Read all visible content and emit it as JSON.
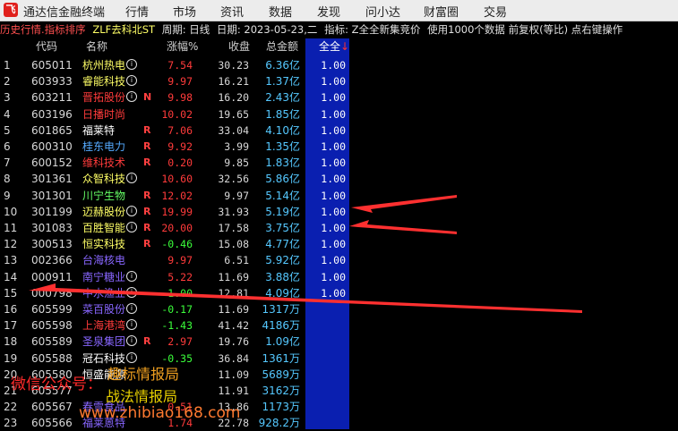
{
  "app": {
    "title": "通达信金融终端"
  },
  "menu": [
    "行情",
    "市场",
    "资讯",
    "数据",
    "发现",
    "问小达",
    "财富圈",
    "交易"
  ],
  "infobar": {
    "mode": "历史行情.指标排序",
    "formula": "ZLF去科北ST",
    "period": "周期: 日线",
    "date": "日期: 2023-05-23,二",
    "indicator": "指标: Z全全新集竞价",
    "data_note": "使用1000个数据 前复权(等比) 点右键操作"
  },
  "headers": {
    "code": "代码",
    "name": "名称",
    "chg": "涨幅%",
    "close": "收盘",
    "amount": "总金额",
    "all": "全全"
  },
  "colors": {
    "up": "#ff3b3b",
    "down": "#3bff3b",
    "name_default": "#ffff66",
    "selected_col": "#0a1fb0",
    "arrow": "#ff3030"
  },
  "rows": [
    {
      "idx": "1",
      "code": "605011",
      "name": "杭州热电",
      "info": true,
      "flag": "",
      "chg": "7.54",
      "close": "30.23",
      "amount": "6.36亿",
      "all": "1.00",
      "nc": "#ffff66",
      "cc": "#ff3b3b"
    },
    {
      "idx": "2",
      "code": "603933",
      "name": "睿能科技",
      "info": true,
      "flag": "",
      "chg": "9.97",
      "close": "16.21",
      "amount": "1.37亿",
      "all": "1.00",
      "nc": "#ffff66",
      "cc": "#ff3b3b"
    },
    {
      "idx": "3",
      "code": "603211",
      "name": "晋拓股份",
      "info": true,
      "flag": "N",
      "chg": "9.98",
      "close": "16.20",
      "amount": "2.43亿",
      "all": "1.00",
      "nc": "#ff3b3b",
      "cc": "#ff3b3b"
    },
    {
      "idx": "4",
      "code": "603196",
      "name": "日播时尚",
      "info": false,
      "flag": "",
      "chg": "10.02",
      "close": "19.65",
      "amount": "1.85亿",
      "all": "1.00",
      "nc": "#ff3b3b",
      "cc": "#ff3b3b"
    },
    {
      "idx": "5",
      "code": "601865",
      "name": "福莱特",
      "info": false,
      "flag": "R",
      "chg": "7.06",
      "close": "33.04",
      "amount": "4.10亿",
      "all": "1.00",
      "nc": "#ffffff",
      "cc": "#ff3b3b"
    },
    {
      "idx": "6",
      "code": "600310",
      "name": "桂东电力",
      "info": false,
      "flag": "R",
      "chg": "9.92",
      "close": "3.99",
      "amount": "1.35亿",
      "all": "1.00",
      "nc": "#55aaff",
      "cc": "#ff3b3b"
    },
    {
      "idx": "7",
      "code": "600152",
      "name": "维科技术",
      "info": false,
      "flag": "R",
      "chg": "0.20",
      "close": "9.85",
      "amount": "1.83亿",
      "all": "1.00",
      "nc": "#ff3b3b",
      "cc": "#ff3b3b"
    },
    {
      "idx": "8",
      "code": "301361",
      "name": "众智科技",
      "info": true,
      "flag": "",
      "chg": "10.60",
      "close": "32.56",
      "amount": "5.86亿",
      "all": "1.00",
      "nc": "#ffff66",
      "cc": "#ff3b3b"
    },
    {
      "idx": "9",
      "code": "301301",
      "name": "川宁生物",
      "info": false,
      "flag": "R",
      "chg": "12.02",
      "close": "9.97",
      "amount": "5.14亿",
      "all": "1.00",
      "nc": "#66ff66",
      "cc": "#ff3b3b"
    },
    {
      "idx": "10",
      "code": "301199",
      "name": "迈赫股份",
      "info": true,
      "flag": "R",
      "chg": "19.99",
      "close": "31.93",
      "amount": "5.19亿",
      "all": "1.00",
      "nc": "#ffff66",
      "cc": "#ff3b3b"
    },
    {
      "idx": "11",
      "code": "301083",
      "name": "百胜智能",
      "info": true,
      "flag": "R",
      "chg": "20.00",
      "close": "17.58",
      "amount": "3.75亿",
      "all": "1.00",
      "nc": "#ffff66",
      "cc": "#ff3b3b"
    },
    {
      "idx": "12",
      "code": "300513",
      "name": "恒实科技",
      "info": false,
      "flag": "R",
      "chg": "-0.46",
      "close": "15.08",
      "amount": "4.77亿",
      "all": "1.00",
      "nc": "#ffff66",
      "cc": "#3bff3b"
    },
    {
      "idx": "13",
      "code": "002366",
      "name": "台海核电",
      "info": false,
      "flag": "",
      "chg": "9.97",
      "close": "6.51",
      "amount": "5.92亿",
      "all": "1.00",
      "nc": "#8866ff",
      "cc": "#ff3b3b"
    },
    {
      "idx": "14",
      "code": "000911",
      "name": "南宁糖业",
      "info": true,
      "flag": "",
      "chg": "5.22",
      "close": "11.69",
      "amount": "3.88亿",
      "all": "1.00",
      "nc": "#8866ff",
      "cc": "#ff3b3b"
    },
    {
      "idx": "15",
      "code": "000798",
      "name": "中水渔业",
      "info": true,
      "flag": "",
      "chg": "-1.00",
      "close": "12.81",
      "amount": "4.09亿",
      "all": "1.00",
      "nc": "#8866ff",
      "cc": "#3bff3b"
    },
    {
      "idx": "16",
      "code": "605599",
      "name": "菜百股份",
      "info": true,
      "flag": "",
      "chg": "-0.17",
      "close": "11.69",
      "amount": "1317万",
      "all": "",
      "nc": "#8866ff",
      "cc": "#3bff3b"
    },
    {
      "idx": "17",
      "code": "605598",
      "name": "上海港湾",
      "info": true,
      "flag": "",
      "chg": "-1.43",
      "close": "41.42",
      "amount": "4186万",
      "all": "",
      "nc": "#ff3b3b",
      "cc": "#3bff3b"
    },
    {
      "idx": "18",
      "code": "605589",
      "name": "圣泉集团",
      "info": true,
      "flag": "R",
      "chg": "2.97",
      "close": "19.76",
      "amount": "1.09亿",
      "all": "",
      "nc": "#8866ff",
      "cc": "#ff3b3b"
    },
    {
      "idx": "19",
      "code": "605588",
      "name": "冠石科技",
      "info": true,
      "flag": "",
      "chg": "-0.35",
      "close": "36.84",
      "amount": "1361万",
      "all": "",
      "nc": "#ffffff",
      "cc": "#3bff3b"
    },
    {
      "idx": "20",
      "code": "605580",
      "name": "恒盛能源",
      "info": false,
      "flag": "",
      "chg": "",
      "close": "11.09",
      "amount": "5689万",
      "all": "",
      "nc": "#ffffff",
      "cc": "#ff3b3b"
    },
    {
      "idx": "21",
      "code": "605577",
      "name": "",
      "info": false,
      "flag": "",
      "chg": "",
      "close": "11.91",
      "amount": "3162万",
      "all": "",
      "nc": "#ffffff",
      "cc": "#ff3b3b"
    },
    {
      "idx": "22",
      "code": "605567",
      "name": "春雪食品",
      "info": false,
      "flag": "",
      "chg": "0.51",
      "close": "13.86",
      "amount": "1173万",
      "all": "",
      "nc": "#8866ff",
      "cc": "#ff3b3b"
    },
    {
      "idx": "23",
      "code": "605566",
      "name": "福莱蒽特",
      "info": false,
      "flag": "",
      "chg": "1.74",
      "close": "22.78",
      "amount": "928.2万",
      "all": "",
      "nc": "#8866ff",
      "cc": "#ff3b3b"
    }
  ],
  "watermarks": {
    "w1": "微信公众号：",
    "w2": "趣标情报局",
    "w3": "战法情报局",
    "w4": "www.zhibiao168.com"
  }
}
